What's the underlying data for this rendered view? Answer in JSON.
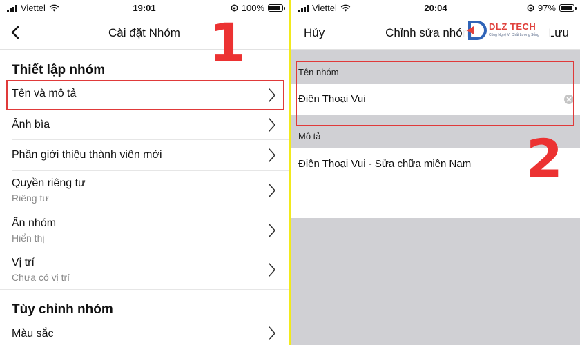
{
  "left": {
    "status": {
      "carrier": "Viettel",
      "time": "19:01",
      "battery": "100%",
      "battery_level": 1.0
    },
    "title": "Cài đặt Nhóm",
    "sections": [
      {
        "title": "Thiết lập nhóm",
        "items": [
          {
            "label": "Tên và mô tả"
          },
          {
            "label": "Ảnh bìa"
          },
          {
            "label": "Phần giới thiệu thành viên mới"
          },
          {
            "label": "Quyền riêng tư",
            "subtitle": "Riêng tư"
          },
          {
            "label": "Ẩn nhóm",
            "subtitle": "Hiển thị"
          },
          {
            "label": "Vị trí",
            "subtitle": "Chưa có vị trí"
          }
        ]
      },
      {
        "title": "Tùy chỉnh nhóm",
        "items": [
          {
            "label": "Màu sắc"
          }
        ]
      }
    ],
    "step_number": "1"
  },
  "right": {
    "status": {
      "carrier": "Viettel",
      "time": "20:04",
      "battery": "97%",
      "battery_level": 0.97
    },
    "cancel_label": "Hủy",
    "title": "Chỉnh sửa nhóm",
    "save_label": "Lưu",
    "name_label": "Tên nhóm",
    "name_value": "Điện Thoại Vui",
    "description_label": "Mô tả",
    "description_value": "Điện Thoại Vui - Sửa chữa miền Nam",
    "step_number": "2"
  },
  "watermark": {
    "brand": "DLZ TECH",
    "tagline": "Công Nghệ Vì Chất Lượng Sống"
  },
  "colors": {
    "highlight": "#e03a3a",
    "step_number": "#ec3232",
    "divider": "#f2ea1c",
    "gray_background": "#d0d0d4"
  }
}
